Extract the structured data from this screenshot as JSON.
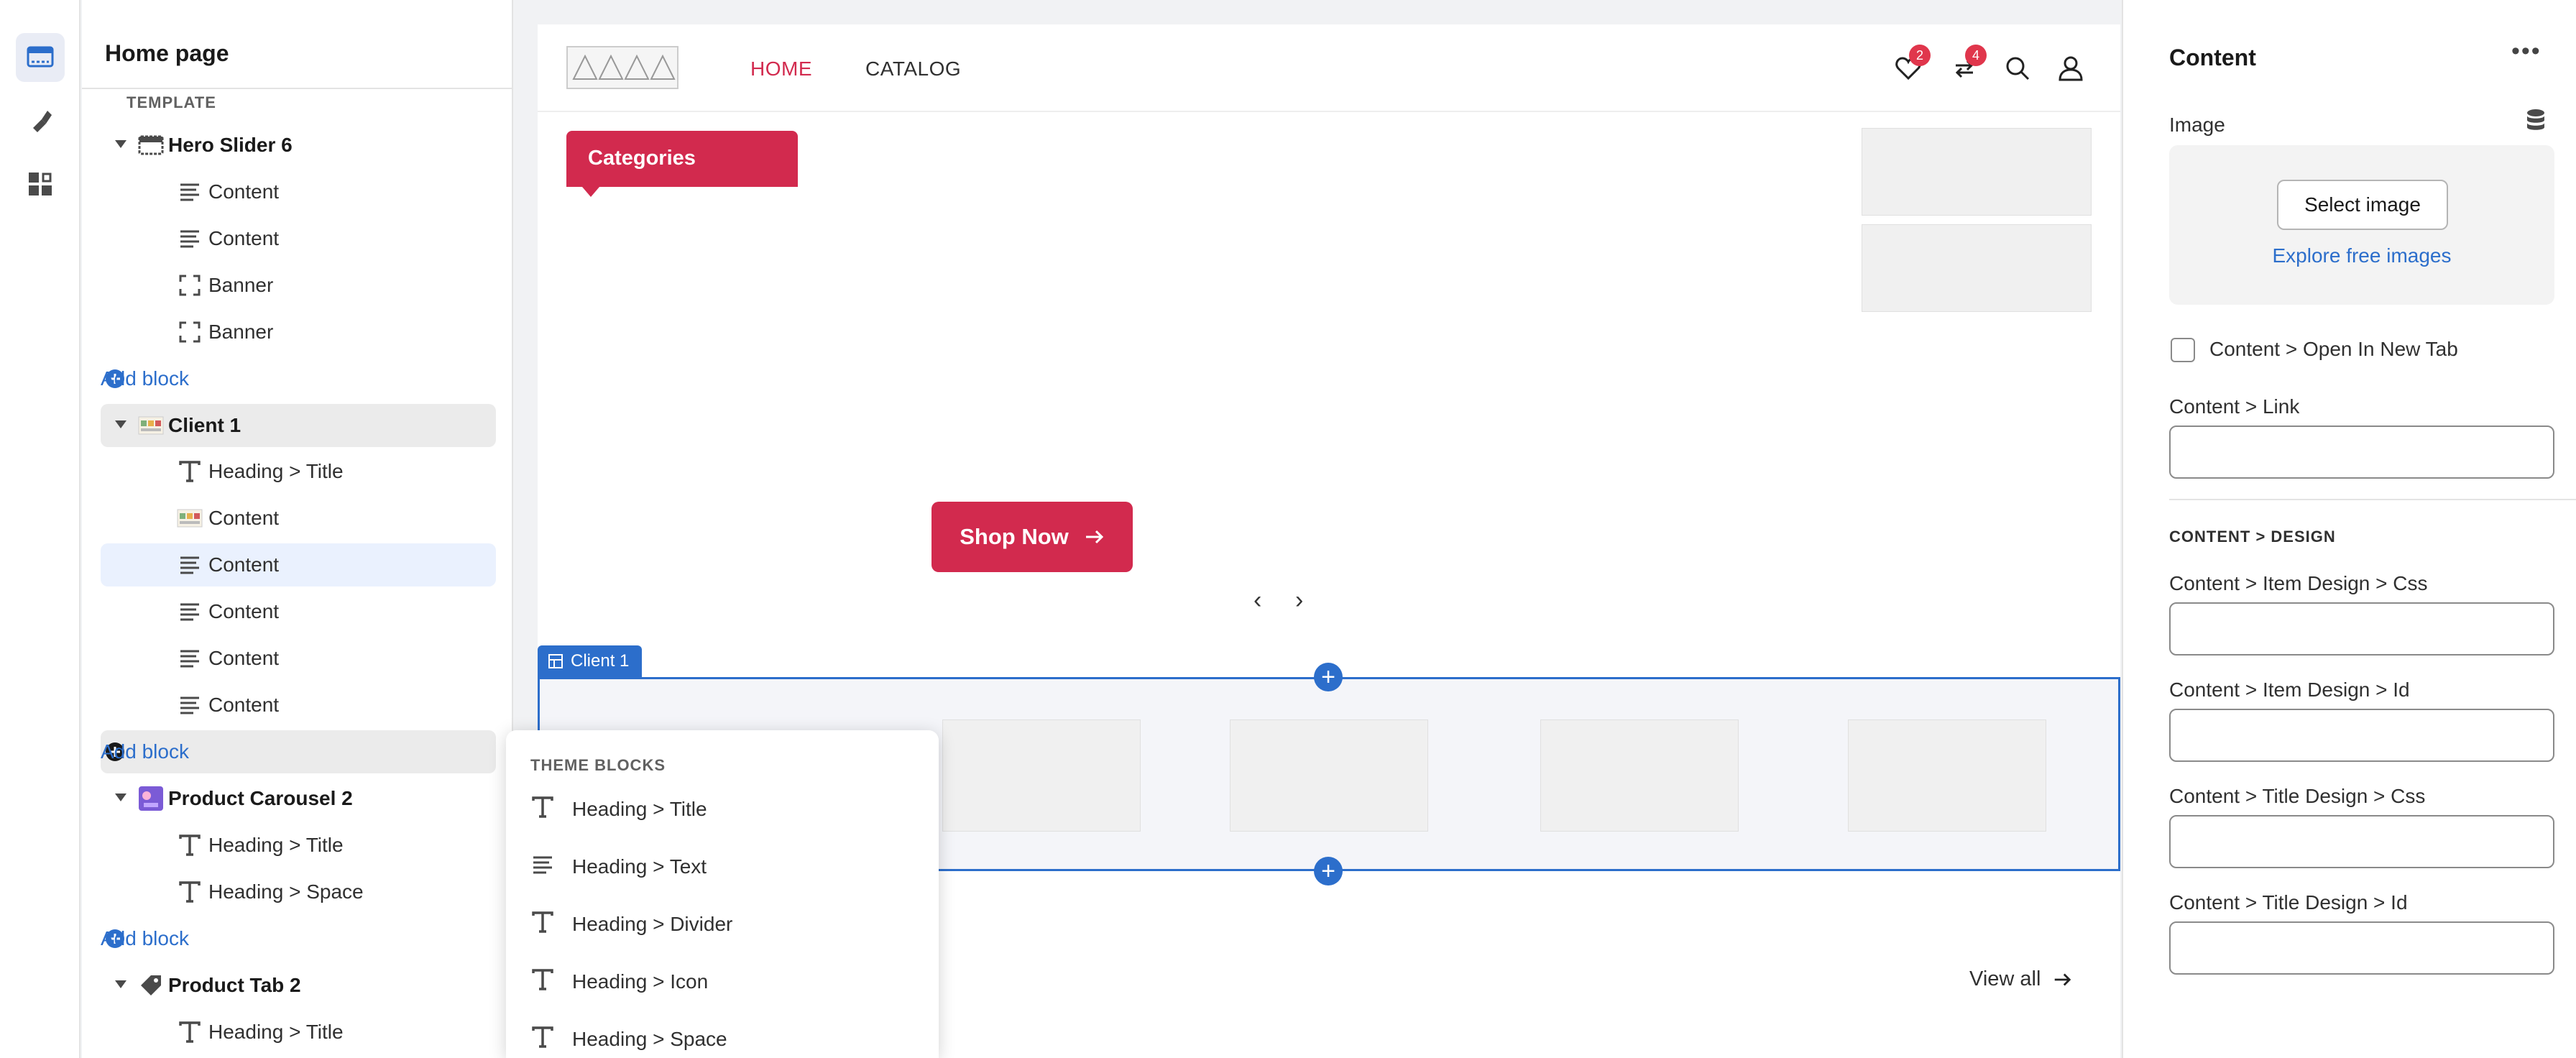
{
  "sidebar": {
    "title": "Home page",
    "template_label": "TEMPLATE",
    "rows": [
      {
        "label": "Hero Slider 6",
        "kind": "section",
        "icon": "slideshow-icon"
      },
      {
        "label": "Content",
        "kind": "child",
        "icon": "text-lines-icon"
      },
      {
        "label": "Content",
        "kind": "child",
        "icon": "text-lines-icon"
      },
      {
        "label": "Banner",
        "kind": "child",
        "icon": "frame-icon"
      },
      {
        "label": "Banner",
        "kind": "child",
        "icon": "frame-icon"
      },
      {
        "label": "Add block",
        "kind": "add",
        "icon": "plus-circle-icon"
      },
      {
        "label": "Client 1",
        "kind": "section",
        "icon": "client-thumbnail-icon"
      },
      {
        "label": "Heading > Title",
        "kind": "child",
        "icon": "heading-t-icon"
      },
      {
        "label": "Content",
        "kind": "child",
        "icon": "image-thumbnail-icon"
      },
      {
        "label": "Content",
        "kind": "child",
        "icon": "text-lines-icon"
      },
      {
        "label": "Content",
        "kind": "child",
        "icon": "text-lines-icon"
      },
      {
        "label": "Content",
        "kind": "child",
        "icon": "text-lines-icon"
      },
      {
        "label": "Content",
        "kind": "child",
        "icon": "text-lines-icon"
      },
      {
        "label": "Add block",
        "kind": "add",
        "icon": "plus-circle-filled-icon"
      },
      {
        "label": "Product Carousel 2",
        "kind": "section",
        "icon": "carousel-thumbnail-icon"
      },
      {
        "label": "Heading > Title",
        "kind": "child",
        "icon": "heading-t-icon"
      },
      {
        "label": "Heading > Space",
        "kind": "child",
        "icon": "heading-t-icon"
      },
      {
        "label": "Add block",
        "kind": "add",
        "icon": "plus-circle-icon"
      },
      {
        "label": "Product Tab 2",
        "kind": "section",
        "icon": "tag-icon"
      },
      {
        "label": "Heading > Title",
        "kind": "child",
        "icon": "heading-t-icon"
      }
    ]
  },
  "preview": {
    "nav": {
      "home": "HOME",
      "catalog": "CATALOG"
    },
    "badges": {
      "wishlist": "2",
      "compare": "4"
    },
    "categories_label": "Categories",
    "shop_now_label": "Shop Now",
    "client_tag": "Client 1",
    "view_all_label": "View all"
  },
  "popup": {
    "title": "THEME BLOCKS",
    "items": [
      {
        "label": "Heading > Title",
        "icon": "heading-t-icon"
      },
      {
        "label": "Heading > Text",
        "icon": "text-lines-icon"
      },
      {
        "label": "Heading > Divider",
        "icon": "heading-t-icon"
      },
      {
        "label": "Heading > Icon",
        "icon": "heading-t-icon"
      },
      {
        "label": "Heading > Space",
        "icon": "heading-t-icon"
      }
    ]
  },
  "right_panel": {
    "title": "Content",
    "image_label": "Image",
    "select_image_label": "Select image",
    "explore_label": "Explore free images",
    "open_new_tab_label": "Content > Open In New Tab",
    "link_label": "Content > Link",
    "design_section": "CONTENT > DESIGN",
    "item_css_label": "Content > Item Design > Css",
    "item_id_label": "Content > Item Design > Id",
    "title_css_label": "Content > Title Design > Css",
    "title_id_label": "Content > Title Design > Id"
  },
  "colors": {
    "accent_red": "#d22a4e",
    "editor_blue": "#2c6ecb"
  }
}
